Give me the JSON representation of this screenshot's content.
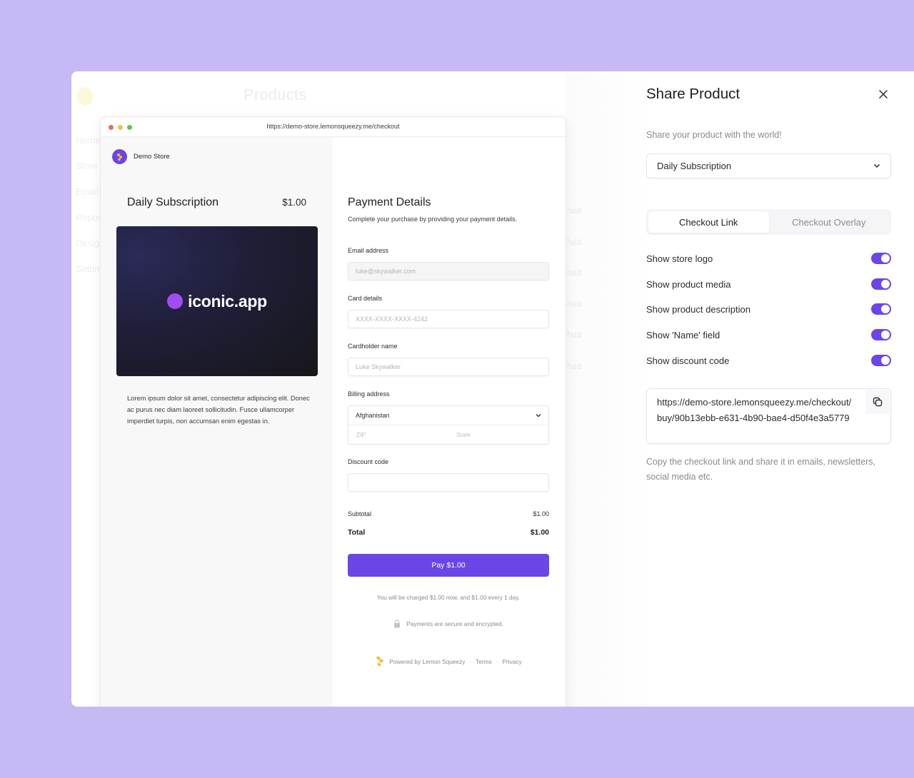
{
  "background": {
    "page_title": "Products",
    "sidebar_items": [
      "Home",
      "Store",
      "Email",
      "Reports",
      "Design",
      "Settings"
    ],
    "column_items": [
      "Paid",
      "Paid",
      "Paid",
      "Paid",
      "Paid",
      "Paid"
    ]
  },
  "browser": {
    "url": "https://demo-store.lemonsqueezy.me/checkout"
  },
  "checkout": {
    "store_name": "Demo Store",
    "product": {
      "name": "Daily Subscription",
      "price": "$1.00",
      "media_text": "iconic.app",
      "description": "Lorem ipsum dolor sit amet, consectetur adipiscing elit. Donec ac purus nec diam laoreet sollicitudin. Fusce ullamcorper imperdiet turpis, non accumsan enim egestas in."
    },
    "payment": {
      "title": "Payment Details",
      "subtitle": "Complete your purchase by providing your payment details.",
      "email_label": "Email address",
      "email_value": "luke@skywalker.com",
      "card_label": "Card details",
      "card_placeholder": "XXXX-XXXX-XXXX-4242",
      "name_label": "Cardholder name",
      "name_placeholder": "Luke Skywalker",
      "billing_label": "Billing address",
      "country_value": "Afghanistan",
      "zip_placeholder": "ZIP",
      "state_placeholder": "State",
      "discount_label": "Discount code",
      "discount_value": "",
      "subtotal_label": "Subtotal",
      "subtotal_value": "$1.00",
      "total_label": "Total",
      "total_value": "$1.00",
      "pay_button": "Pay $1.00",
      "charge_note": "You will be charged $1.00 now, and $1.00 every 1 day.",
      "secure_note": "Payments are secure and encrypted.",
      "powered_by": "Powered by Lemon Squeezy",
      "terms": "Terms",
      "privacy": "Privacy",
      "separator": "·"
    }
  },
  "share": {
    "title": "Share Product",
    "subtitle": "Share your product with the world!",
    "selected_product": "Daily Subscription",
    "tabs": [
      {
        "label": "Checkout Link",
        "active": true
      },
      {
        "label": "Checkout Overlay",
        "active": false
      }
    ],
    "toggles": [
      {
        "label": "Show store logo",
        "on": true
      },
      {
        "label": "Show product media",
        "on": true
      },
      {
        "label": "Show product description",
        "on": true
      },
      {
        "label": "Show 'Name' field",
        "on": true
      },
      {
        "label": "Show discount code",
        "on": true
      }
    ],
    "checkout_link": "https://demo-store.lemonsqueezy.me/checkout/buy/90b13ebb-e631-4b90-bae4-d50f4e3a5779",
    "link_hint": "Copy the checkout link and share it in emails, newsletters, social media etc."
  },
  "colors": {
    "accent": "#6a46e6",
    "page_background": "#c6b9f4",
    "media_dot": "#a14cf0"
  }
}
